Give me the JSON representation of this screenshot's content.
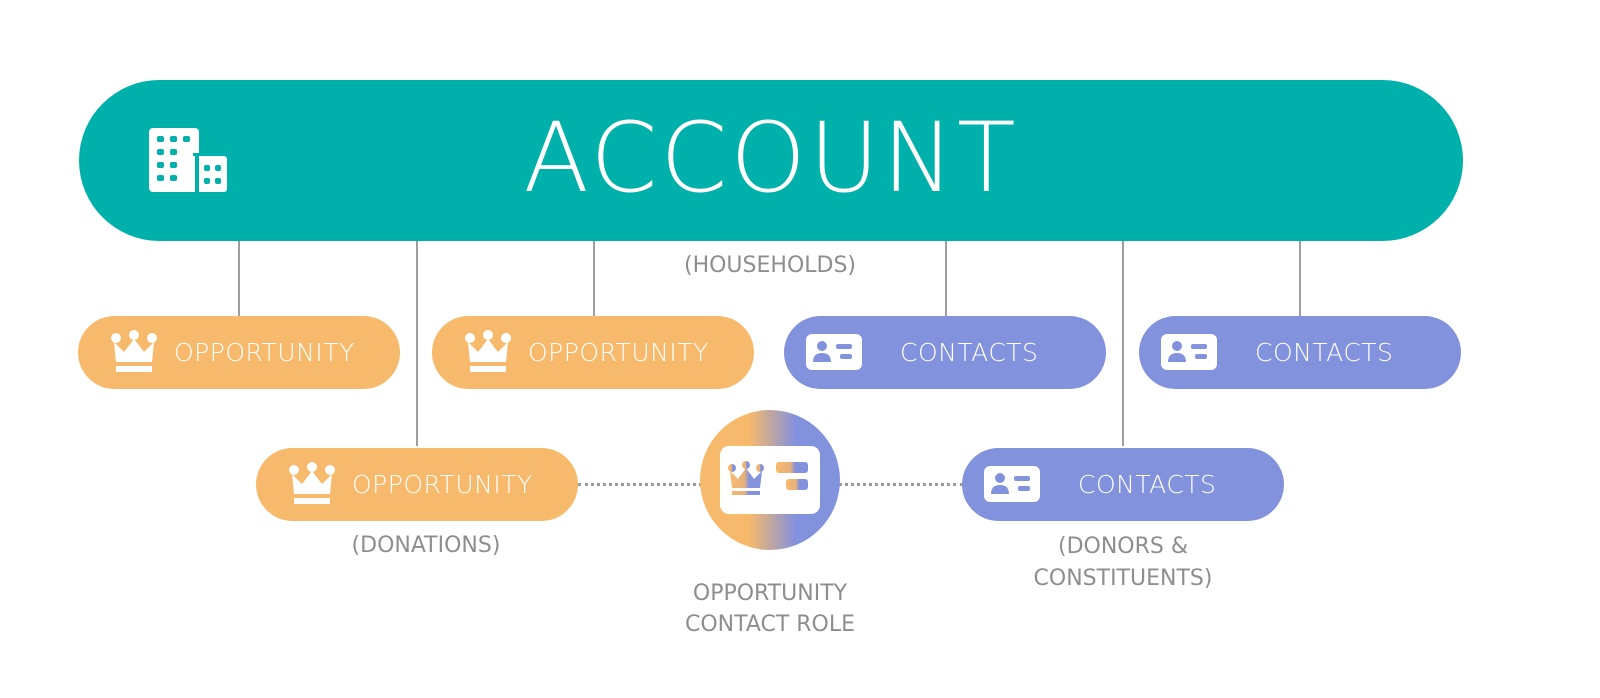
{
  "diagram": {
    "account": {
      "title": "ACCOUNT",
      "subtitle": "(HOUSEHOLDS)",
      "icon": "building-icon",
      "color": "#00b0aa"
    },
    "top_row": [
      {
        "type": "opportunity",
        "label": "OPPORTUNITY",
        "icon": "crown-icon",
        "color": "#f7b96b"
      },
      {
        "type": "opportunity",
        "label": "OPPORTUNITY",
        "icon": "crown-icon",
        "color": "#f7b96b"
      },
      {
        "type": "contact",
        "label": "CONTACTS",
        "icon": "contact-card-icon",
        "color": "#8392dd"
      },
      {
        "type": "contact",
        "label": "CONTACTS",
        "icon": "contact-card-icon",
        "color": "#8392dd"
      }
    ],
    "bottom_row": {
      "opportunity": {
        "label": "OPPORTUNITY",
        "caption": "(DONATIONS)",
        "icon": "crown-icon"
      },
      "role": {
        "caption_line1": "OPPORTUNITY",
        "caption_line2": "CONTACT ROLE",
        "icon": "opportunity-contact-role-icon"
      },
      "contact": {
        "label": "CONTACTS",
        "caption_line1": "(DONORS &",
        "caption_line2": "CONSTITUENTS)",
        "icon": "contact-card-icon"
      }
    }
  }
}
